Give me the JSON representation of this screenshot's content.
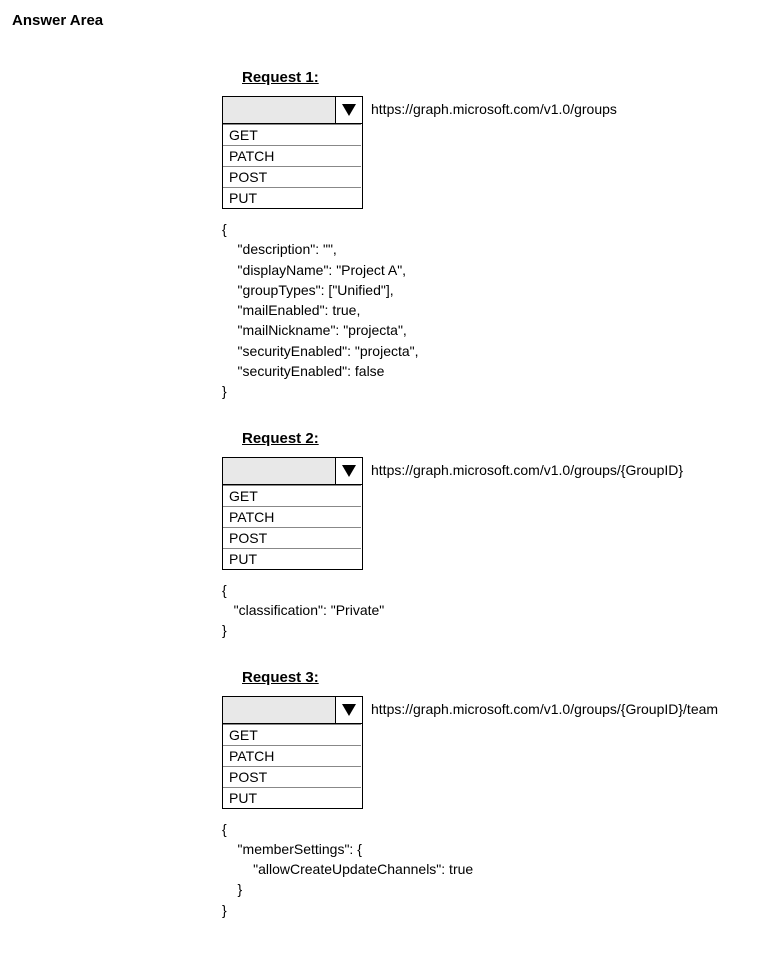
{
  "page": {
    "title": "Answer Area"
  },
  "requests": [
    {
      "heading": "Request 1:",
      "url": "https://graph.microsoft.com/v1.0/groups",
      "options": [
        "GET",
        "PATCH",
        "POST",
        "PUT"
      ],
      "body_lines": [
        "{",
        "    \"description\": \"\",",
        "    \"displayName\": \"Project A\",",
        "    \"groupTypes\": [\"Unified\"],",
        "    \"mailEnabled\": true,",
        "    \"mailNickname\": \"projecta\",",
        "    \"securityEnabled\": \"projecta\",",
        "    \"securityEnabled\": false",
        "}"
      ]
    },
    {
      "heading": "Request 2:",
      "url": "https://graph.microsoft.com/v1.0/groups/{GroupID}",
      "options": [
        "GET",
        "PATCH",
        "POST",
        "PUT"
      ],
      "body_lines": [
        "{",
        "   \"classification\": \"Private\"",
        "}"
      ]
    },
    {
      "heading": "Request 3:",
      "url": "https://graph.microsoft.com/v1.0/groups/{GroupID}/team",
      "options": [
        "GET",
        "PATCH",
        "POST",
        "PUT"
      ],
      "body_lines": [
        "{",
        "    \"memberSettings\": {",
        "        \"allowCreateUpdateChannels\": true",
        "    }",
        "}"
      ]
    }
  ]
}
